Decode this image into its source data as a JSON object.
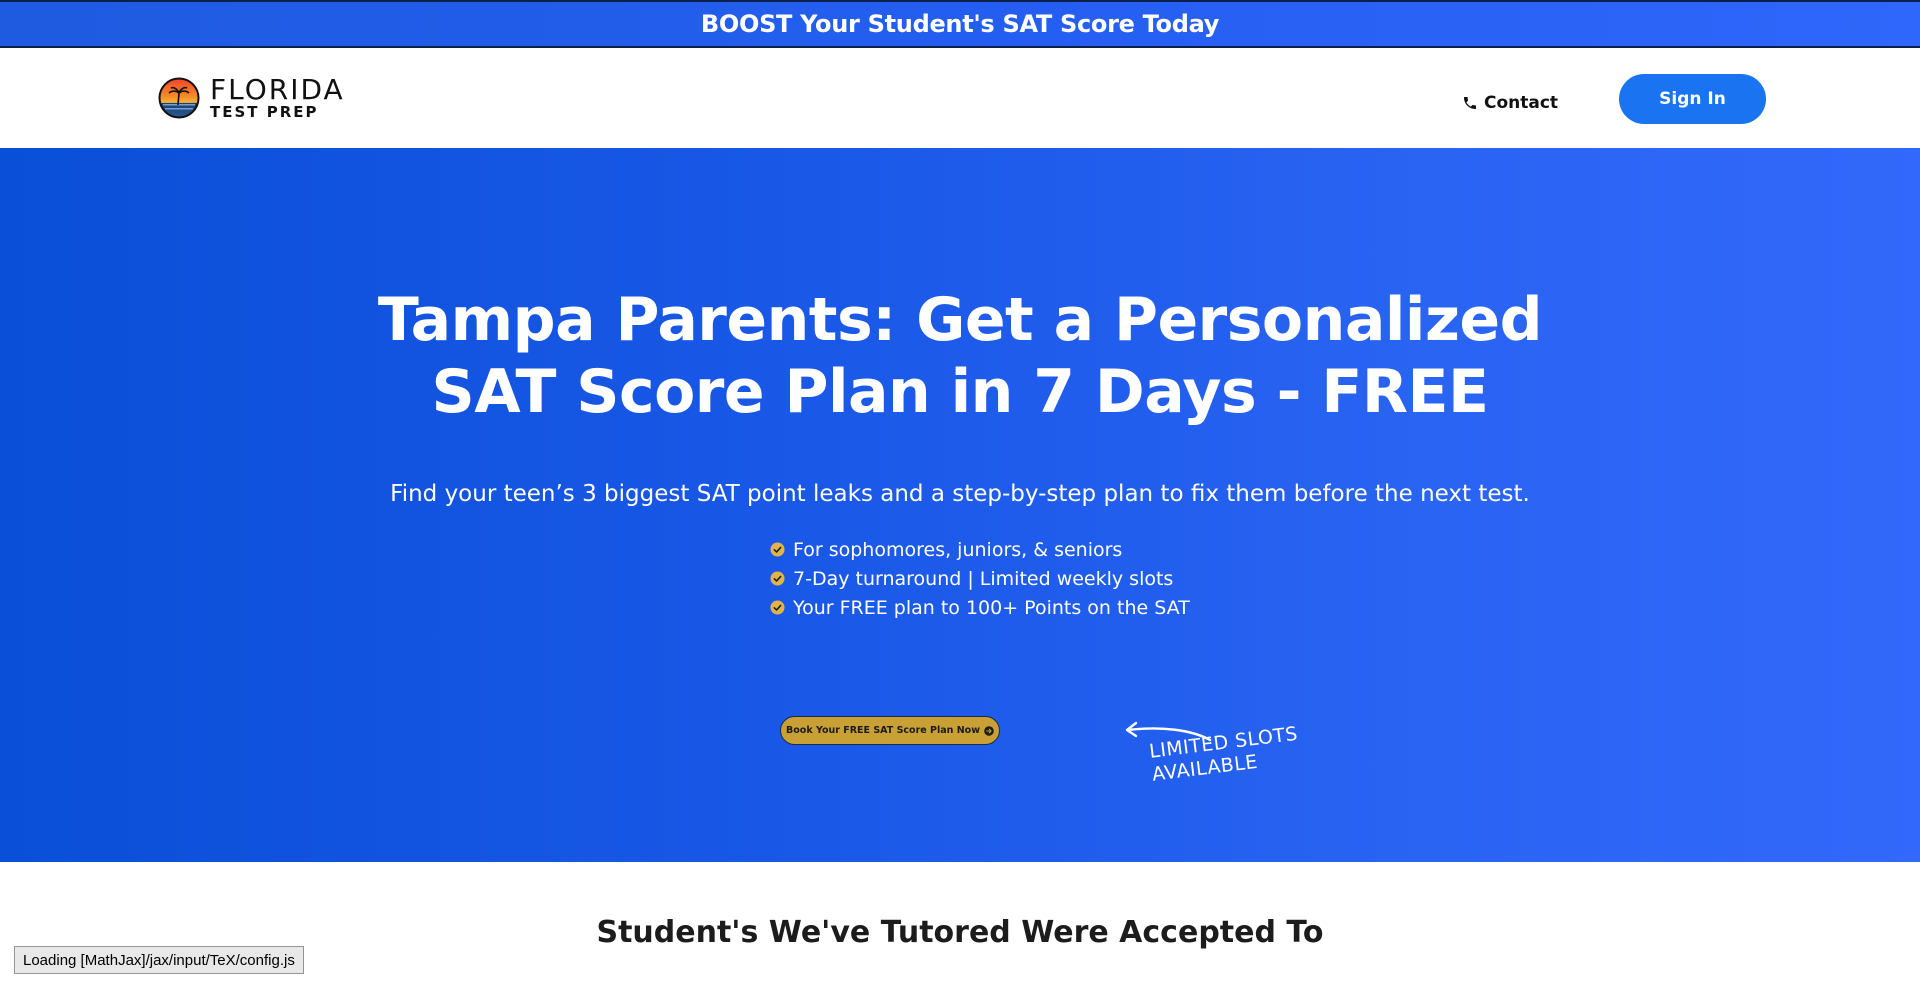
{
  "announcement": {
    "text": "BOOST Your Student's SAT Score Today"
  },
  "header": {
    "logo": {
      "main": "FLORIDA",
      "sub": "TEST PREP"
    },
    "contact_label": "Contact",
    "signin_label": "Sign In"
  },
  "hero": {
    "title_line1": "Tampa Parents: Get a Personalized",
    "title_line2": "SAT Score Plan in 7 Days - FREE",
    "subtitle": "Find your teen’s 3 biggest SAT point leaks and a step-by-step plan to fix them before the next test.",
    "checklist": [
      "For sophomores, juniors, & seniors",
      "7-Day turnaround | Limited weekly slots",
      "Your FREE plan to 100+ Points on the SAT"
    ],
    "cta_label": "Book Your FREE SAT Score Plan Now",
    "limited_line1": "LIMITED SLOTS",
    "limited_line2": "AVAILABLE"
  },
  "section": {
    "accepted_heading": "Student's We've Tutored Were Accepted To"
  },
  "status": {
    "text": "Loading [MathJax]/jax/input/TeX/config.js"
  },
  "colors": {
    "accent_blue": "#1a73f0",
    "hero_blue": "#1b59e8",
    "cta_gold": "#c9a035",
    "check_gold": "#e2b447"
  },
  "icons": {
    "contact": "phone-icon",
    "check": "check-circle-icon",
    "cta": "arrow-right-circle-icon",
    "logo": "sunset-palm-icon"
  }
}
